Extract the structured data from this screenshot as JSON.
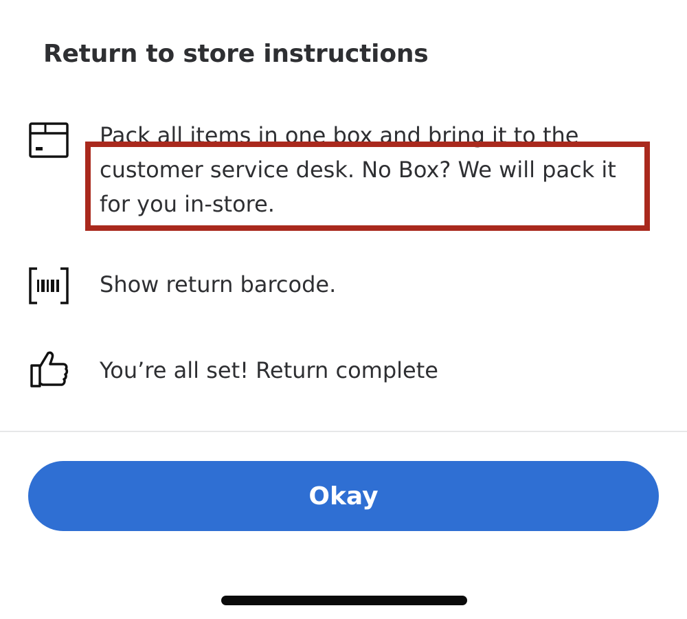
{
  "modal": {
    "title": "Return to store instructions"
  },
  "steps": [
    {
      "icon": "box-icon",
      "text": "Pack all items in one box and bring it to the customer service desk. No Box? We will pack it for you in-store."
    },
    {
      "icon": "barcode-scan-icon",
      "text": "Show return barcode."
    },
    {
      "icon": "thumbs-up-icon",
      "text": "You’re all set! Return complete"
    }
  ],
  "footer": {
    "okay_label": "Okay"
  },
  "colors": {
    "primary_button": "#2f6fd3",
    "highlight_border": "#a9291d",
    "text": "#2e2f32"
  }
}
